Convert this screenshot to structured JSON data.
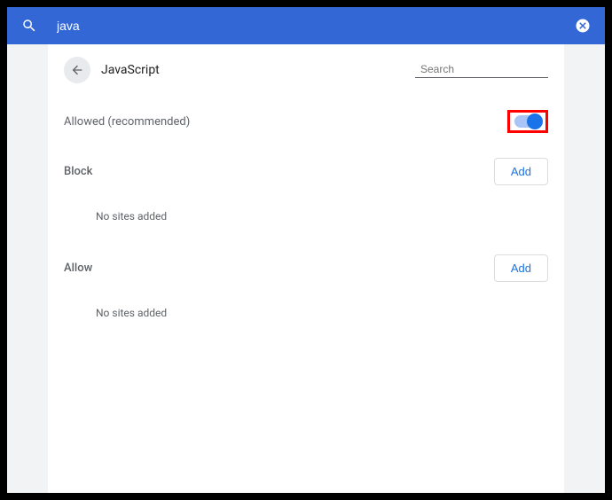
{
  "topbar": {
    "search_value": "java",
    "close_label": "Close"
  },
  "panel": {
    "title": "JavaScript",
    "search_placeholder": "Search",
    "allowed_label": "Allowed (recommended)",
    "toggle_on": true,
    "block": {
      "label": "Block",
      "add_label": "Add",
      "empty_text": "No sites added"
    },
    "allow": {
      "label": "Allow",
      "add_label": "Add",
      "empty_text": "No sites added"
    }
  },
  "colors": {
    "topbar_bg": "#3367d6",
    "accent": "#1a73e8",
    "highlight": "#ff0000"
  }
}
